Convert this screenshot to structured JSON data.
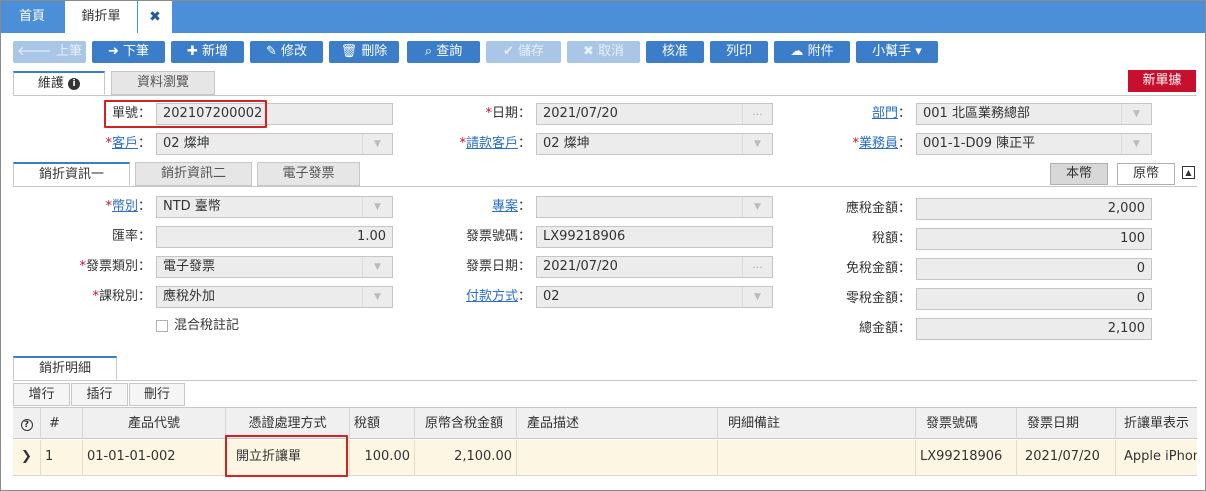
{
  "tabs": {
    "home": "首頁",
    "active": "銷折單",
    "close": "✖"
  },
  "toolbar": {
    "prev": "上筆",
    "next": "下筆",
    "add": "新增",
    "edit": "修改",
    "delete": "刪除",
    "query": "查詢",
    "save": "儲存",
    "cancel": "取消",
    "approve": "核准",
    "print": "列印",
    "attach": "附件",
    "helper": "小幫手"
  },
  "form_tabs": {
    "maintain": "維護",
    "browse": "資料瀏覽"
  },
  "new_doc": "新單據",
  "header_fields": {
    "doc_no_label": "單號",
    "doc_no": "202107200002",
    "date_label": "日期",
    "date": "2021/07/20",
    "dept_label": "部門",
    "dept": "001 北區業務總部",
    "customer_label": "客戶",
    "customer": "02 燦坤",
    "bill_customer_label": "請款客戶",
    "bill_customer": "02 燦坤",
    "sales_label": "業務員",
    "sales": "001-1-D09 陳正平"
  },
  "info_tabs": {
    "tab1": "銷折資訊一",
    "tab2": "銷折資訊二",
    "tab3": "電子發票"
  },
  "currency_toggle": {
    "local": "本幣",
    "foreign": "原幣"
  },
  "info_fields": {
    "currency_label": "幣別",
    "currency": "NTD 臺幣",
    "rate_label": "匯率",
    "rate": "1.00",
    "invoice_type_label": "發票類別",
    "invoice_type": "電子發票",
    "tax_type_label": "課稅別",
    "tax_type": "應稅外加",
    "mixed_tax_label": "混合稅註記",
    "project_label": "專案",
    "project": "",
    "invoice_no_label": "發票號碼",
    "invoice_no": "LX99218906",
    "invoice_date_label": "發票日期",
    "invoice_date": "2021/07/20",
    "payment_label": "付款方式",
    "payment": "02",
    "taxable_label": "應稅金額",
    "taxable": "2,000",
    "tax_label": "稅額",
    "tax": "100",
    "exempt_label": "免稅金額",
    "exempt": "0",
    "zero_label": "零稅金額",
    "zero": "0",
    "total_label": "總金額",
    "total": "2,100"
  },
  "detail": {
    "tab": "銷折明細",
    "add_row": "增行",
    "insert_row": "插行",
    "delete_row": "刪行",
    "columns": [
      "#",
      "產品代號",
      "憑證處理方式",
      "稅額",
      "原幣含稅金額",
      "產品描述",
      "明細備註",
      "發票號碼",
      "發票日期",
      "折讓單表示"
    ],
    "rows": [
      {
        "no": "1",
        "product_code": "01-01-01-002",
        "voucher_method": "開立折讓單",
        "tax": "100.00",
        "amount": "2,100.00",
        "description": "",
        "remark": "",
        "invoice_no": "LX99218906",
        "invoice_date": "2021/07/20",
        "allowance": "Apple iPhon"
      }
    ]
  }
}
